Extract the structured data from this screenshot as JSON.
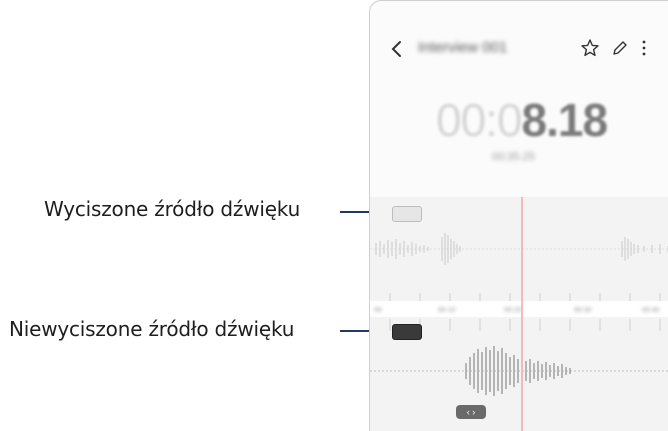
{
  "callouts": {
    "muted_source": "Wyciszone źródło dźwięku",
    "unmuted_source": "Niewyciszone źródło dźwięku"
  },
  "recorder": {
    "title": "Interview 001",
    "timer_faint": "00:0",
    "timer_strong": "8.18",
    "total_time": "00:35.25",
    "handle_glyph": "‹ ›",
    "timeline_marks": [
      "00",
      "00:10",
      "00:20",
      "00:30",
      "00:40"
    ]
  },
  "icons": [
    "back-icon",
    "star-icon",
    "edit-icon",
    "more-icon"
  ],
  "colors": {
    "callout_line": "#1f3a5f",
    "playhead": "#f3a0a6",
    "muted_track": "#e6e6e6",
    "unmuted_track": "#3a3a3a"
  }
}
